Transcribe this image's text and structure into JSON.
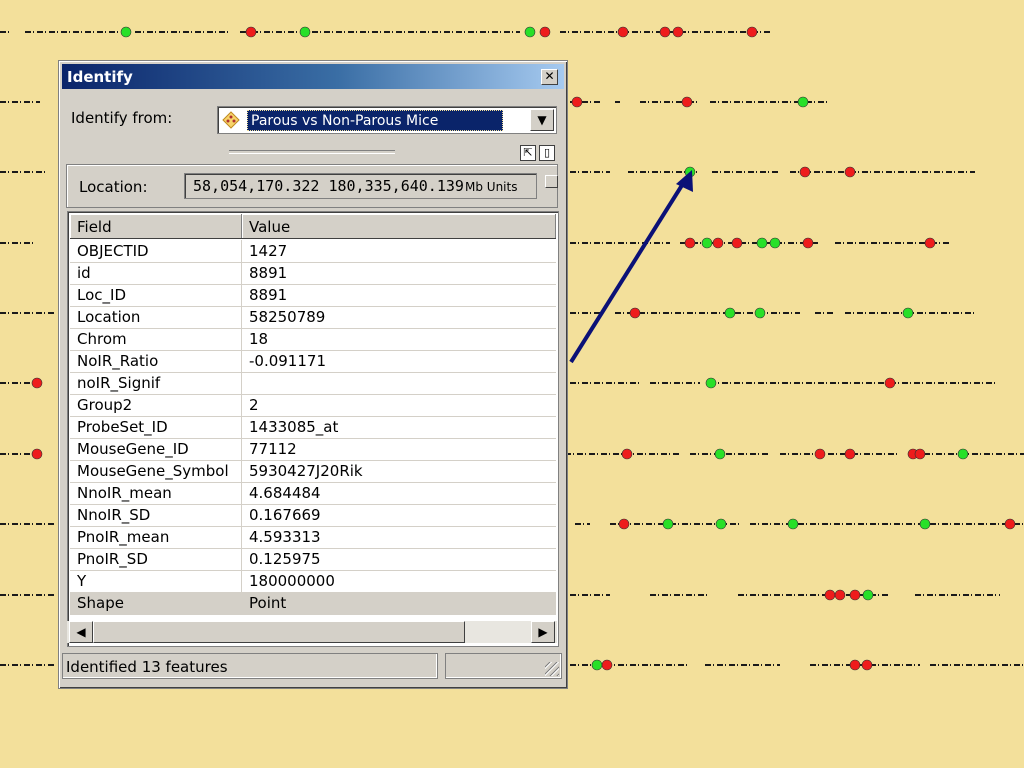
{
  "window": {
    "title": "Identify",
    "close_symbol": "✕"
  },
  "identify_from": {
    "label": "Identify from:",
    "layer": "Parous vs Non-Parous Mice",
    "layer_icon": "layer-diamond-icon",
    "dropdown_symbol": "▼"
  },
  "toolbar": {
    "expand_symbol": "⇱",
    "panel_symbol": "▯"
  },
  "location": {
    "label": "Location:",
    "value": "58,054,170.322  180,335,640.139",
    "units": "Mb Units"
  },
  "grid": {
    "headers": {
      "field": "Field",
      "value": "Value"
    },
    "rows": [
      {
        "field": "OBJECTID",
        "value": "1427"
      },
      {
        "field": "id",
        "value": "8891"
      },
      {
        "field": "Loc_ID",
        "value": "8891"
      },
      {
        "field": "Location",
        "value": "58250789"
      },
      {
        "field": "Chrom",
        "value": "18"
      },
      {
        "field": "NoIR_Ratio",
        "value": "-0.091171"
      },
      {
        "field": "noIR_Signif",
        "value": ""
      },
      {
        "field": "Group2",
        "value": "2"
      },
      {
        "field": "ProbeSet_ID",
        "value": "1433085_at"
      },
      {
        "field": "MouseGene_ID",
        "value": "77112"
      },
      {
        "field": "MouseGene_Symbol",
        "value": "5930427J20Rik"
      },
      {
        "field": "NnoIR_mean",
        "value": "4.684484"
      },
      {
        "field": "NnoIR_SD",
        "value": "0.167669"
      },
      {
        "field": "PnoIR_mean",
        "value": "4.593313"
      },
      {
        "field": "PnoIR_SD",
        "value": "0.125975"
      },
      {
        "field": "Y",
        "value": "180000000"
      },
      {
        "field": "Shape",
        "value": "Point"
      }
    ]
  },
  "scrollbar": {
    "left_symbol": "◀",
    "right_symbol": "▶"
  },
  "status": {
    "text": "Identified 13 features"
  },
  "colors": {
    "background": "#f3e09b",
    "marker_red": "#ee1c1c",
    "marker_green": "#28e028",
    "track": "#1a1a1a",
    "pointer_arrow": "#0b1177",
    "title_active": "#0a246a"
  }
}
